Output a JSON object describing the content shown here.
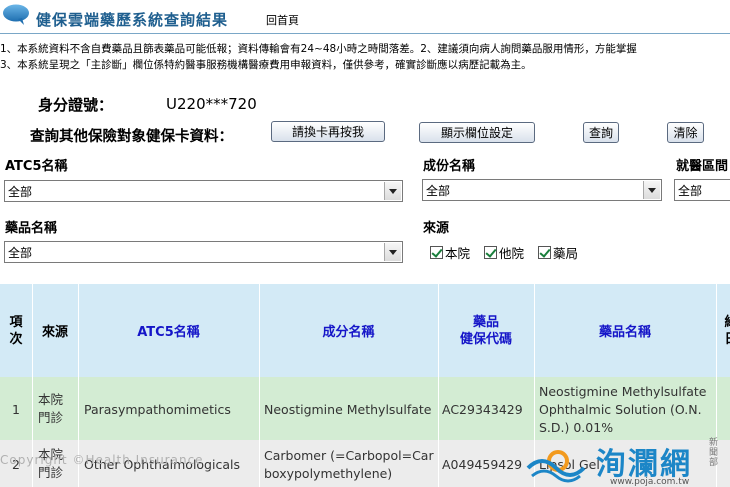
{
  "header": {
    "title": "健保雲端藥歷系統查詢結果",
    "home_link": "回首頁",
    "icon": "speech-bubble-icon"
  },
  "notices": [
    "1、本系統資料不含自費藥品且篩表藥品可能低報；資料傳輸會有24~48小時之時間落差。2、建議須向病人詢問藥品服用情形，方能掌握",
    "3、本系統呈現之「主診斷」欄位係特約醫事服務機構醫療費用申報資料，僅供參考，確實診斷應以病歷記載為主。"
  ],
  "patient": {
    "id_label": "身分證號：",
    "id_value": "U220***720"
  },
  "query": {
    "label": "查詢其他保險對象健保卡資料：",
    "reinsert_button": "請換卡再按我",
    "columns_button": "顯示欄位設定",
    "search_button": "查詢",
    "clear_button": "清除"
  },
  "filters": {
    "atc5": {
      "label": "ATC5名稱",
      "value": "全部"
    },
    "ingredient": {
      "label": "成份名稱",
      "value": "全部"
    },
    "region": {
      "label": "就醫區間",
      "value": "全部"
    },
    "drug": {
      "label": "藥品名稱",
      "value": "全部"
    },
    "source": {
      "label": "來源",
      "options": [
        "本院",
        "他院",
        "藥局"
      ]
    }
  },
  "table": {
    "headers": {
      "index": "項次",
      "source": "來源",
      "atc5": "ATC5名稱",
      "ingredient": "成分名稱",
      "code_line1": "藥品",
      "code_line2": "健保代碼",
      "drug": "藥品名稱",
      "extra_line1": "給",
      "extra_line2": "日"
    },
    "rows": [
      {
        "index": "1",
        "source_line1": "本院",
        "source_line2": "門診",
        "atc5": "Parasympathomimetics",
        "ingredient": "Neostigmine Methylsulfate",
        "code": "AC29343429",
        "drug_line1": "Neostigmine Methylsulfate",
        "drug_line2": "Ophthalmic Solution (O.N.",
        "drug_line3": "S.D.) 0.01%"
      },
      {
        "index": "2",
        "source_line1": "本院",
        "source_line2": "門診",
        "atc5": "Other Ophthalmologicals",
        "ingredient_line1": "Carbomer (=Carbopol=Car",
        "ingredient_line2": "boxypolymethylene)",
        "code": "A049459429",
        "drug_line1": "Lipsol Gel"
      }
    ]
  },
  "watermark": {
    "text": "Copyright ©Health Insurance",
    "logo_text": "洵瀾網",
    "logo_side": "新聞部",
    "logo_url": "www.poja.com.tw"
  },
  "colors": {
    "title": "#1f5f8f",
    "header_bg": "#d3eaf6",
    "row1_bg": "#d3ecd3",
    "row2_bg": "#ececec",
    "link_blue": "#1515c8"
  }
}
